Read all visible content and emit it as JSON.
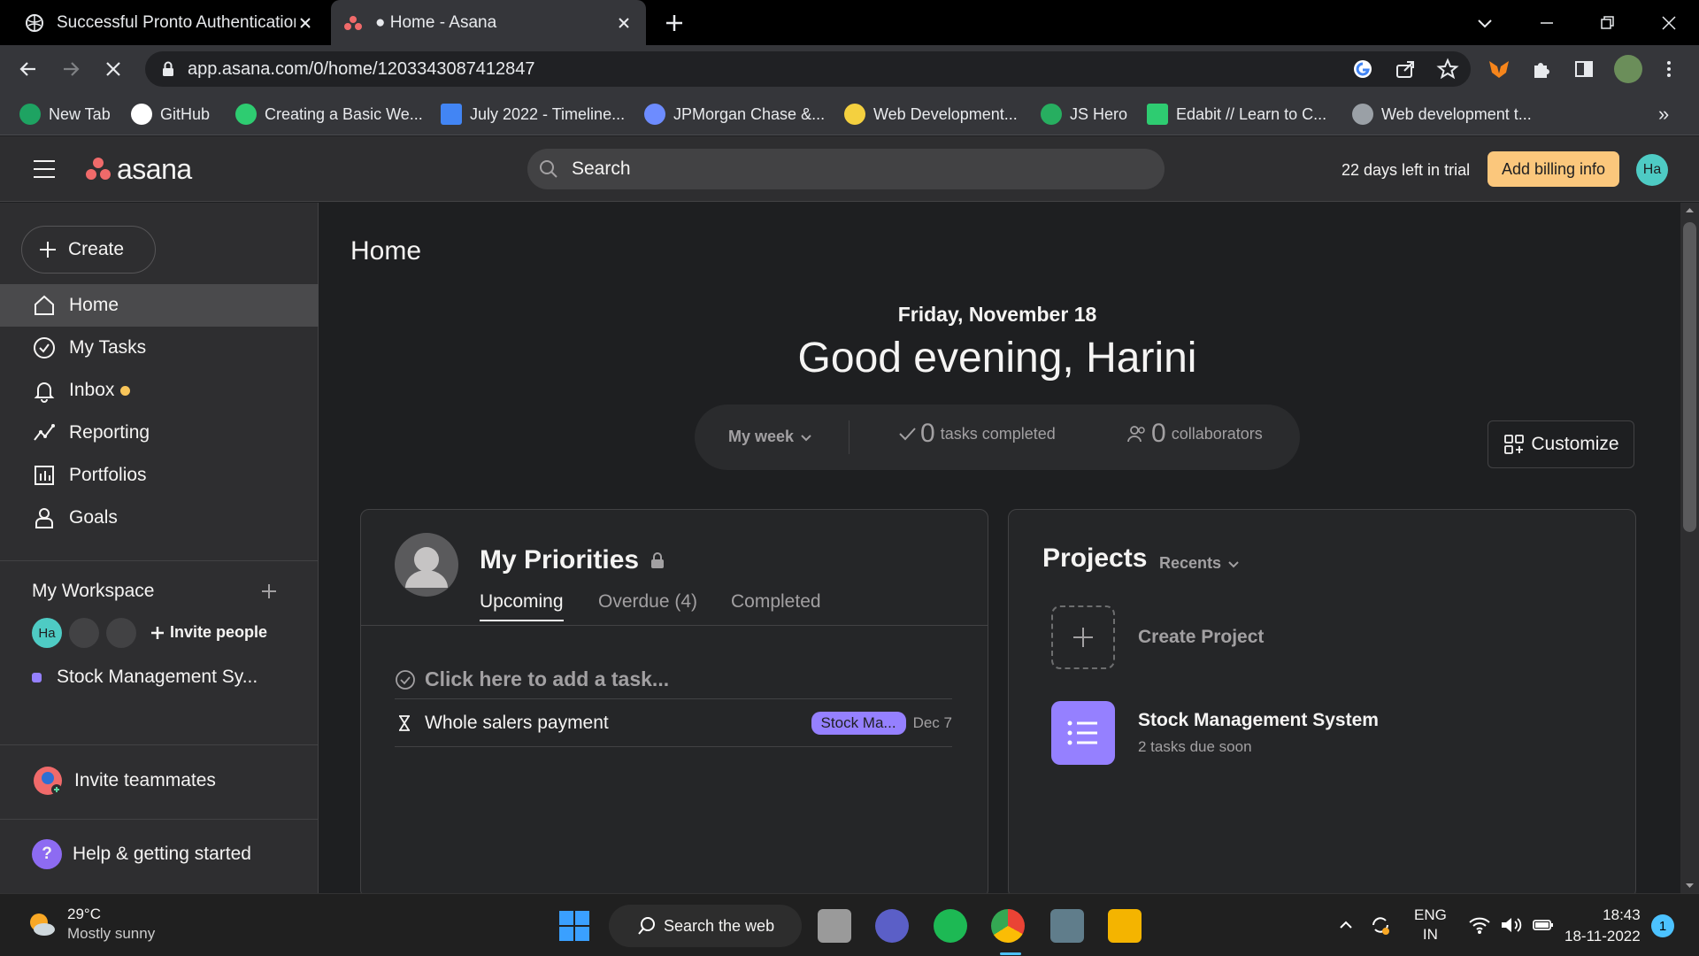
{
  "browser": {
    "tabs": [
      {
        "label": "Successful Pronto Authentication",
        "active": false
      },
      {
        "label": "● Home - Asana",
        "active": true
      }
    ],
    "url": "app.asana.com/0/home/1203343087412847",
    "bookmarks": [
      {
        "label": "New Tab",
        "icon": "new-tab-icon",
        "color": "#1ea362"
      },
      {
        "label": "GitHub",
        "icon": "github-icon",
        "color": "#ffffff"
      },
      {
        "label": "Creating a Basic We...",
        "icon": "spiral-icon",
        "color": "#2ecc71"
      },
      {
        "label": "July 2022 - Timeline...",
        "icon": "docs-icon",
        "color": "#4285f4"
      },
      {
        "label": "JPMorgan Chase &...",
        "icon": "yello-icon",
        "color": "#6d8cff"
      },
      {
        "label": "Web Development...",
        "icon": "lock-badge-icon",
        "color": "#f4d03f"
      },
      {
        "label": "JS Hero",
        "icon": "js-hero-icon",
        "color": "#27ae60"
      },
      {
        "label": "Edabit // Learn to C...",
        "icon": "edabit-icon",
        "color": "#2ecc71"
      },
      {
        "label": "Web development t...",
        "icon": "globe-icon",
        "color": "#9aa0a6"
      }
    ]
  },
  "topbar": {
    "logo_text": "asana",
    "search_placeholder": "Search",
    "trial_text": "22 days left in trial",
    "billing_label": "Add billing info",
    "user_initials": "Ha"
  },
  "sidebar": {
    "create_label": "Create",
    "nav": [
      {
        "label": "Home",
        "icon": "home-icon",
        "selected": true
      },
      {
        "label": "My Tasks",
        "icon": "check-circle-icon"
      },
      {
        "label": "Inbox",
        "icon": "bell-icon",
        "unread": true
      },
      {
        "label": "Reporting",
        "icon": "chart-line-icon"
      },
      {
        "label": "Portfolios",
        "icon": "portfolio-icon"
      },
      {
        "label": "Goals",
        "icon": "person-goal-icon"
      }
    ],
    "workspace": {
      "title": "My Workspace",
      "member_initials": "Ha",
      "invite_label": "Invite people",
      "project": "Stock Management Sy..."
    },
    "invite_teammates": "Invite teammates",
    "help": "Help & getting started"
  },
  "main": {
    "title": "Home",
    "date": "Friday, November 18",
    "greeting": "Good evening, Harini",
    "stats": {
      "period": "My week",
      "tasks_count": "0",
      "tasks_label": "tasks completed",
      "collab_count": "0",
      "collab_label": "collaborators"
    },
    "customize_label": "Customize",
    "priorities": {
      "title": "My Priorities",
      "tabs": [
        "Upcoming",
        "Overdue (4)",
        "Completed"
      ],
      "add_task": "Click here to add a task...",
      "tasks": [
        {
          "name": "Whole salers payment",
          "project": "Stock Ma...",
          "due": "Dec 7"
        }
      ]
    },
    "projects": {
      "title": "Projects",
      "filter": "Recents",
      "create_label": "Create Project",
      "items": [
        {
          "name": "Stock Management System",
          "subtitle": "2 tasks due soon",
          "color": "#9580ff"
        }
      ]
    }
  },
  "taskbar": {
    "weather_temp": "29°C",
    "weather_desc": "Mostly sunny",
    "search_label": "Search the web",
    "lang_top": "ENG",
    "lang_bottom": "IN",
    "time": "18:43",
    "date": "18-11-2022",
    "notifications": "1"
  }
}
